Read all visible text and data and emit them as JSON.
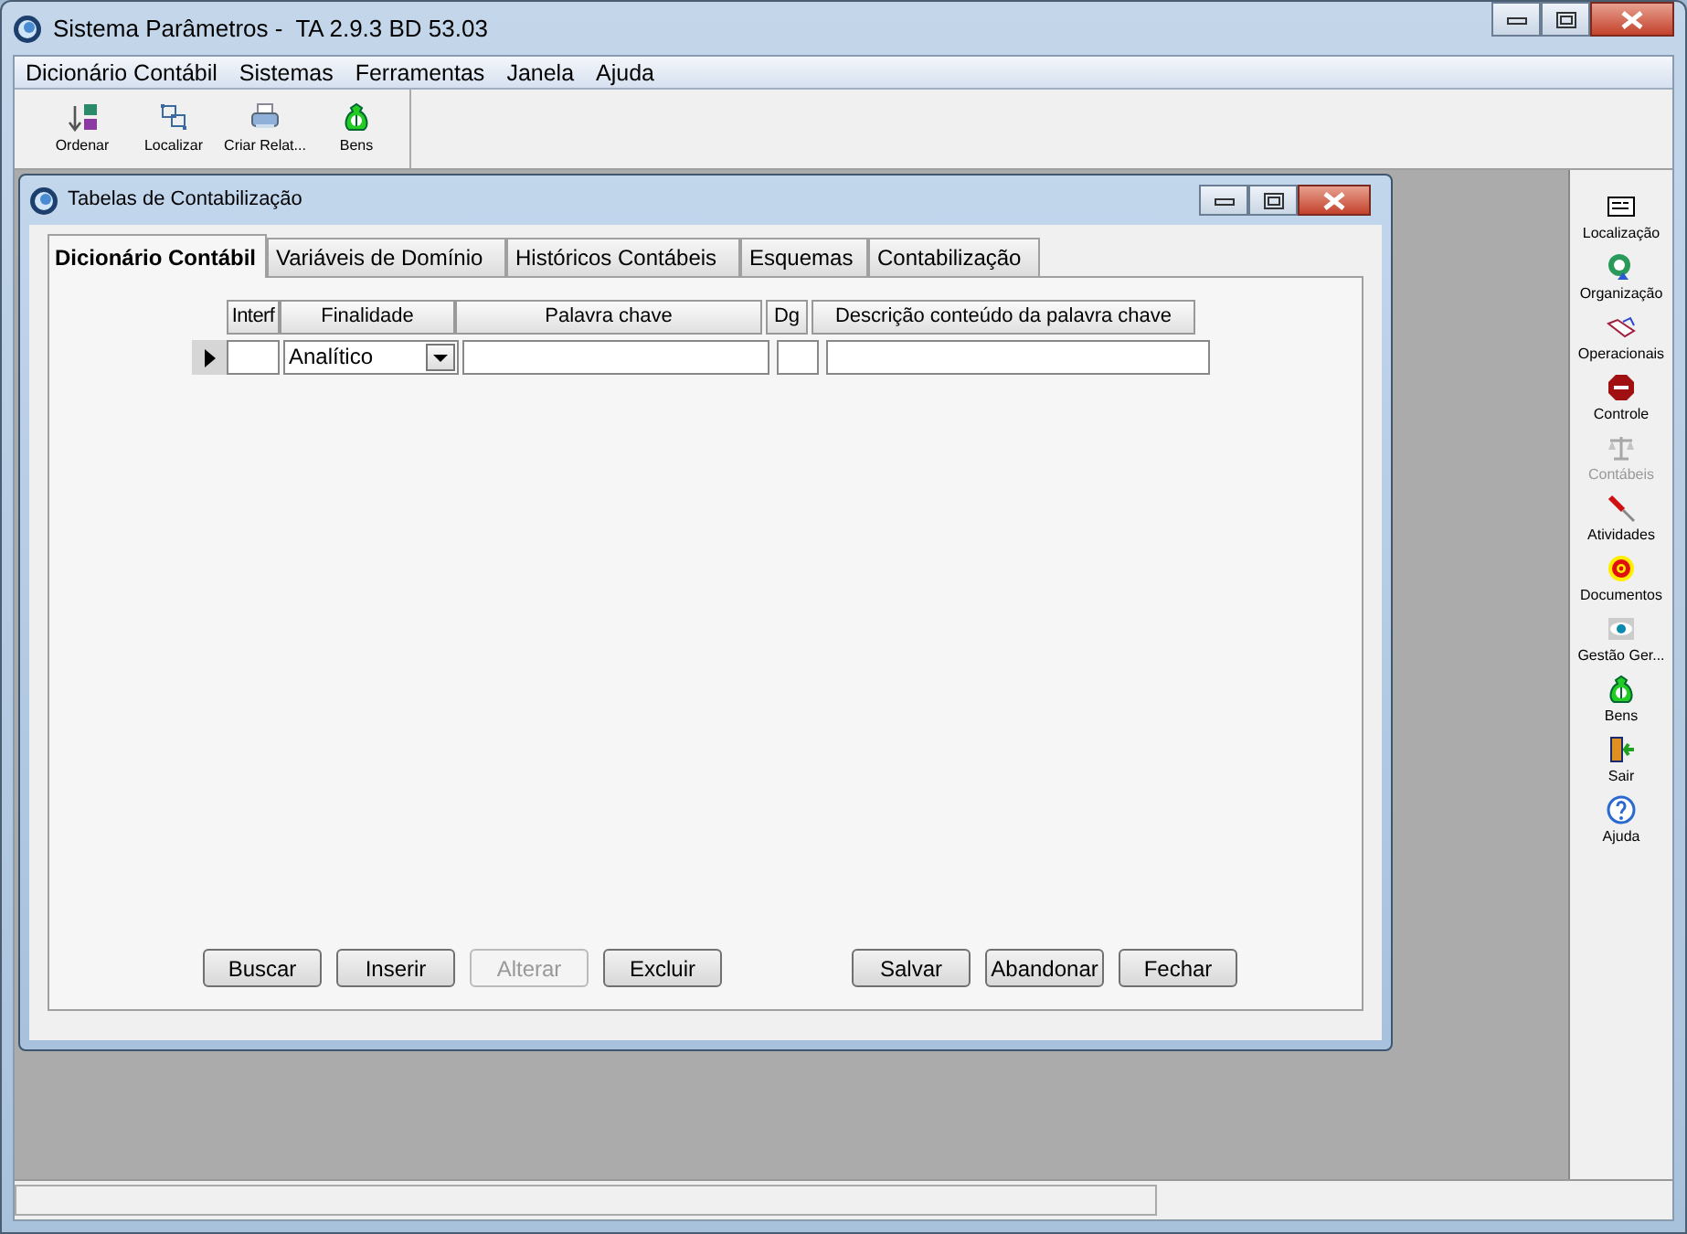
{
  "window": {
    "title": "Sistema Parâmetros -  TA 2.9.3 BD 53.03"
  },
  "menu": [
    "Dicionário Contábil",
    "Sistemas",
    "Ferramentas",
    "Janela",
    "Ajuda"
  ],
  "toolbar": [
    {
      "label": "Ordenar"
    },
    {
      "label": "Localizar"
    },
    {
      "label": "Criar Relat..."
    },
    {
      "label": "Bens"
    }
  ],
  "sidebar": {
    "items": [
      {
        "label": "Localização",
        "disabled": false
      },
      {
        "label": "Organização",
        "disabled": false
      },
      {
        "label": "Operacionais",
        "disabled": false
      },
      {
        "label": "Controle",
        "disabled": false
      },
      {
        "label": "Contábeis",
        "disabled": true
      },
      {
        "label": "Atividades",
        "disabled": false
      },
      {
        "label": "Documentos",
        "disabled": false
      },
      {
        "label": "Gestão Ger...",
        "disabled": false
      },
      {
        "label": "Bens",
        "disabled": false
      },
      {
        "label": "Sair",
        "disabled": false
      },
      {
        "label": "Ajuda",
        "disabled": false
      }
    ]
  },
  "child_window": {
    "title": "Tabelas de Contabilização",
    "tabs": [
      {
        "label": "Dicionário Contábil",
        "selected": true
      },
      {
        "label": "Variáveis de Domínio",
        "selected": false
      },
      {
        "label": "Históricos Contábeis",
        "selected": false
      },
      {
        "label": "Esquemas",
        "selected": false
      },
      {
        "label": "Contabilização",
        "selected": false
      }
    ],
    "table": {
      "columns": [
        "Interf",
        "Finalidade",
        "Palavra chave",
        "Dg",
        "Descrição conteúdo da palavra chave"
      ],
      "rows": [
        {
          "current": true,
          "cells": [
            {
              "kind": "text"
            },
            {
              "kind": "dropdown",
              "value": "Analítico"
            },
            {
              "kind": "text"
            },
            {
              "kind": "text"
            },
            {
              "kind": "text"
            }
          ]
        }
      ]
    },
    "buttons": [
      {
        "label": "Buscar",
        "disabled": false
      },
      {
        "label": "Inserir",
        "disabled": false
      },
      {
        "label": "Alterar",
        "disabled": true
      },
      {
        "label": "Excluir",
        "disabled": false
      },
      {
        "label": "Salvar",
        "disabled": false
      },
      {
        "label": "Abandonar",
        "disabled": false
      },
      {
        "label": "Fechar",
        "disabled": false
      }
    ]
  }
}
